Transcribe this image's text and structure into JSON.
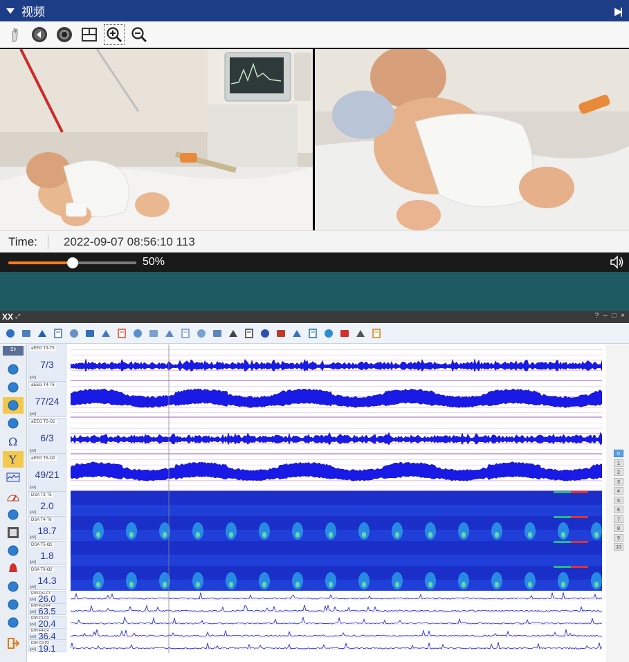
{
  "video": {
    "title": "视频",
    "time_label": "Time:",
    "timestamp": "2022-09-07 08:56:10 113",
    "playback_percent": 50,
    "playback_label": "50%"
  },
  "app": {
    "logo": "XX",
    "pin": "⤢",
    "window_controls": "? – □ ×"
  },
  "channels": [
    {
      "name": "aEEG T3-T5",
      "value": "7/3",
      "unit": "[uV]",
      "kind": "aeeg"
    },
    {
      "name": "aEEG T4-T6",
      "value": "77/24",
      "unit": "[uV]",
      "kind": "aeeg"
    },
    {
      "name": "aEEG T5-O1",
      "value": "6/3",
      "unit": "[uV]",
      "kind": "aeeg"
    },
    {
      "name": "aEEG T6-O2",
      "value": "49/21",
      "unit": "[uV]",
      "kind": "aeeg"
    },
    {
      "name": "DSA T3-T5",
      "value": "2.0",
      "unit": "[uV]",
      "kind": "dsa"
    },
    {
      "name": "DSA T4-T6",
      "value": "18.7",
      "unit": "[uV]",
      "kind": "dsa"
    },
    {
      "name": "DSA T5-O1",
      "value": "1.8",
      "unit": "[uV]",
      "kind": "dsa"
    },
    {
      "name": "DSA T6-O2",
      "value": "14.3",
      "unit": "[uV]",
      "kind": "dsa"
    },
    {
      "name": "ENV-Fp1-F3",
      "value": "26.0",
      "unit": "[uV]",
      "kind": "env"
    },
    {
      "name": "ENV-Fp2-F4",
      "value": "63.5",
      "unit": "[uV]",
      "kind": "env"
    },
    {
      "name": "ENV-F3-C3",
      "value": "20.4",
      "unit": "[uV]",
      "kind": "env"
    },
    {
      "name": "ENV-F4-C4",
      "value": "36.4",
      "unit": "[uV]",
      "kind": "env"
    },
    {
      "name": "ENV-C3-P3",
      "value": "19.1",
      "unit": "[uV]",
      "kind": "env"
    }
  ],
  "page_buttons": [
    "0",
    "1",
    "2",
    "3",
    "4",
    "5",
    "6",
    "7",
    "8",
    "9",
    "10"
  ],
  "selected_page": "0",
  "colors": {
    "header": "#1d3e86",
    "trace": "#1a1ae6",
    "playhead": "#ff7a1a",
    "teal": "#1d5a61"
  }
}
